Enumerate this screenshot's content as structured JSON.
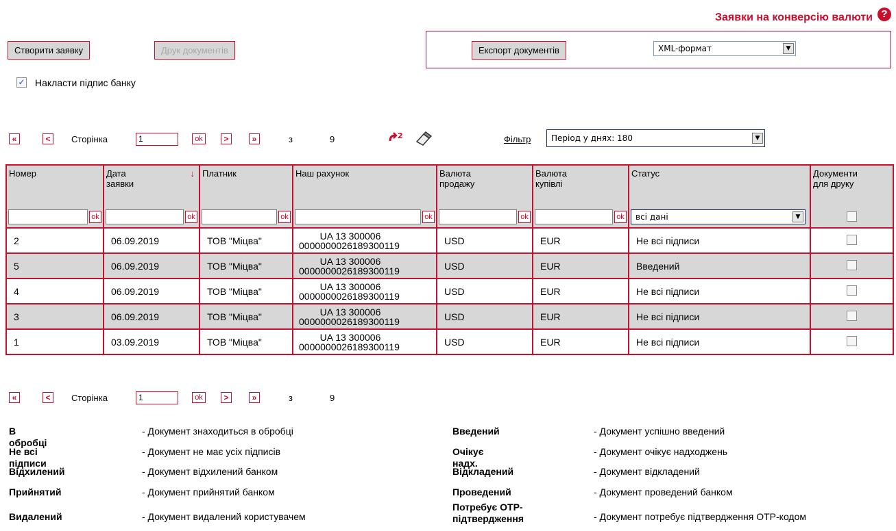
{
  "header": {
    "title": "Заявки на конверсію валюти",
    "help_icon": "?"
  },
  "toolbar": {
    "create_label": "Створити заявку",
    "print_label": "Друк документів",
    "sign_label": "Накласти підпис банку",
    "sign_checked": true,
    "export_label": "Експорт документів",
    "export_format": "XML-формат"
  },
  "pager": {
    "first": "«",
    "prev": "<",
    "next": ">",
    "last": "»",
    "page_label": "Сторінка",
    "page_value": "1",
    "ok": "ok",
    "of_label": "з",
    "total": "9",
    "filter_link": "Фільтр",
    "filter_value": "Період у днях: 180"
  },
  "table": {
    "columns": [
      "Номер",
      "Дата\nзаявки",
      "Платник",
      "Наш рахунок",
      "Валюта\nпродажу",
      "Валюта\nкупівлі",
      "Статус",
      "Документи\nдля друку"
    ],
    "filter_ok": "ok",
    "status_filter": "всі дані",
    "rows": [
      {
        "num": "2",
        "date": "06.09.2019",
        "payer": "ТОВ \"Міцва\"",
        "account_l1": "UA 13 300006",
        "account_l2": "0000000026189300119",
        "sell": "USD",
        "buy": "EUR",
        "status": "Не всі підписи"
      },
      {
        "num": "5",
        "date": "06.09.2019",
        "payer": "ТОВ \"Міцва\"",
        "account_l1": "UA 13 300006",
        "account_l2": "0000000026189300119",
        "sell": "USD",
        "buy": "EUR",
        "status": "Введений"
      },
      {
        "num": "4",
        "date": "06.09.2019",
        "payer": "ТОВ \"Міцва\"",
        "account_l1": "UA 13 300006",
        "account_l2": "0000000026189300119",
        "sell": "USD",
        "buy": "EUR",
        "status": "Не всі підписи"
      },
      {
        "num": "3",
        "date": "06.09.2019",
        "payer": "ТОВ \"Міцва\"",
        "account_l1": "UA 13 300006",
        "account_l2": "0000000026189300119",
        "sell": "USD",
        "buy": "EUR",
        "status": "Не всі підписи"
      },
      {
        "num": "1",
        "date": "03.09.2019",
        "payer": "ТОВ \"Міцва\"",
        "account_l1": "UA 13 300006",
        "account_l2": "0000000026189300119",
        "sell": "USD",
        "buy": "EUR",
        "status": "Не всі підписи"
      }
    ]
  },
  "legend": {
    "left": [
      {
        "term": "В обробці",
        "desc": "- Документ знаходиться в обробці"
      },
      {
        "term": "Не всі підписи",
        "desc": "- Документ не має усіх підписів"
      },
      {
        "term": "Відхилений",
        "desc": "- Документ відхилений банком"
      },
      {
        "term": "Прийнятий",
        "desc": "- Документ прийнятий банком"
      },
      {
        "term": "Видалений",
        "desc": "- Документ видалений користувачем"
      }
    ],
    "right": [
      {
        "term": "Введений",
        "desc": "- Документ успішно введений"
      },
      {
        "term": "Очікує надх.",
        "desc": "- Документ очікує надходжень"
      },
      {
        "term": "Відкладений",
        "desc": "- Документ відкладений"
      },
      {
        "term": "Проведений",
        "desc": "- Документ проведений банком"
      },
      {
        "term": "Потребує OTP-\nпідтвердження",
        "desc": "- Документ потребує підтвердження OTP-кодом"
      }
    ]
  }
}
